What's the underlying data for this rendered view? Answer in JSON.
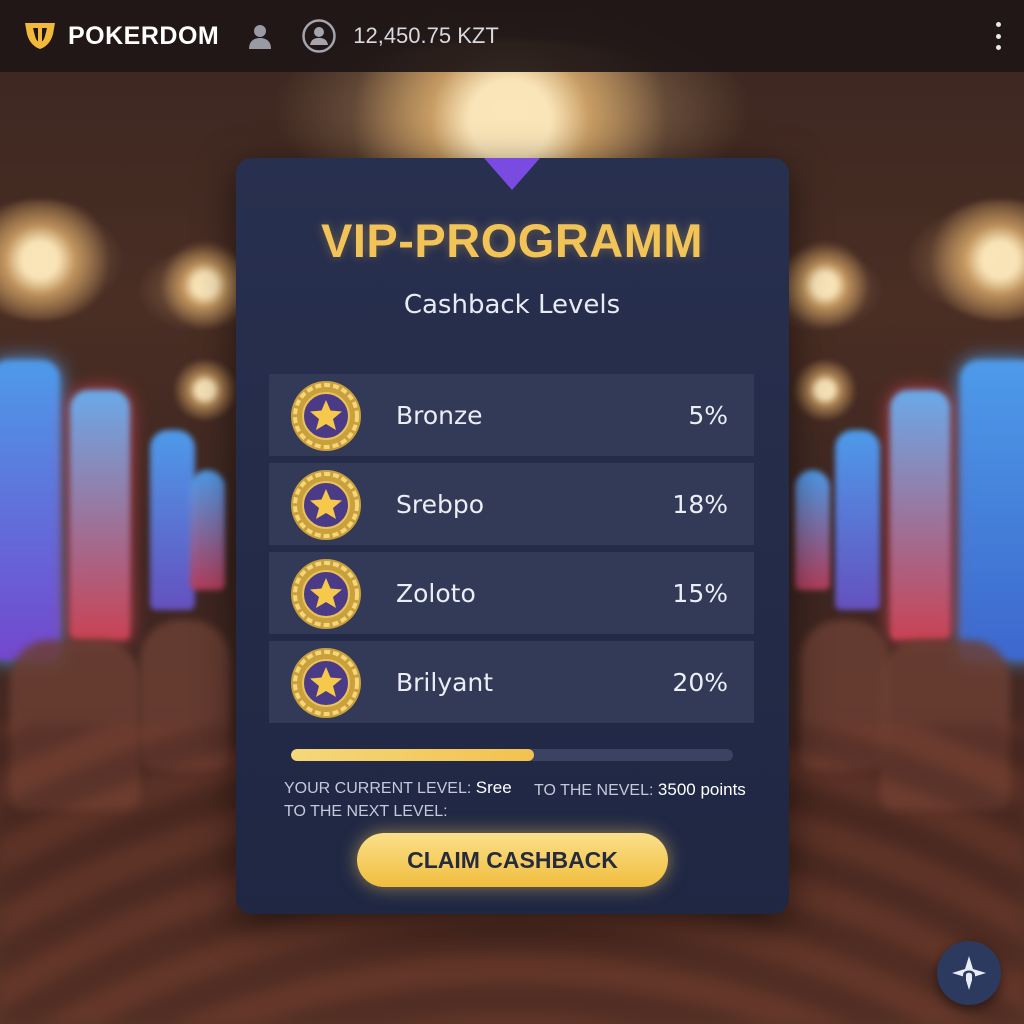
{
  "header": {
    "brand": "POKERDOM",
    "balance": "12,450.75 KZT",
    "icons": {
      "logo": "pokerdom-logo-icon",
      "user": "user-icon",
      "account": "account-circle-icon",
      "menu": "more-vertical-icon"
    }
  },
  "vip": {
    "title": "VIP-PROGRAMM",
    "subtitle": "Cashback Levels",
    "levels": [
      {
        "name": "Bronze",
        "cashback": "5%"
      },
      {
        "name": "Srebpo",
        "cashback": "18%"
      },
      {
        "name": "Zoloto",
        "cashback": "15%"
      },
      {
        "name": "Brilyant",
        "cashback": "20%"
      }
    ],
    "progress_fraction": 0.55,
    "current_level_label": "YOUR CURRENT LEVEL:",
    "current_level_value": "Sree",
    "next_level_label": "TO THE NEXT LEVEL:",
    "nevel_label": "TO THE NEVEL:",
    "nevel_value": "3500 points",
    "claim_button": "CLAIM CASHBACK"
  },
  "colors": {
    "accent_gold": "#f2c457",
    "panel": "#252d4a",
    "notch": "#7a4be0",
    "row": "#323a58"
  },
  "help": {
    "icon": "support-chat-icon"
  }
}
